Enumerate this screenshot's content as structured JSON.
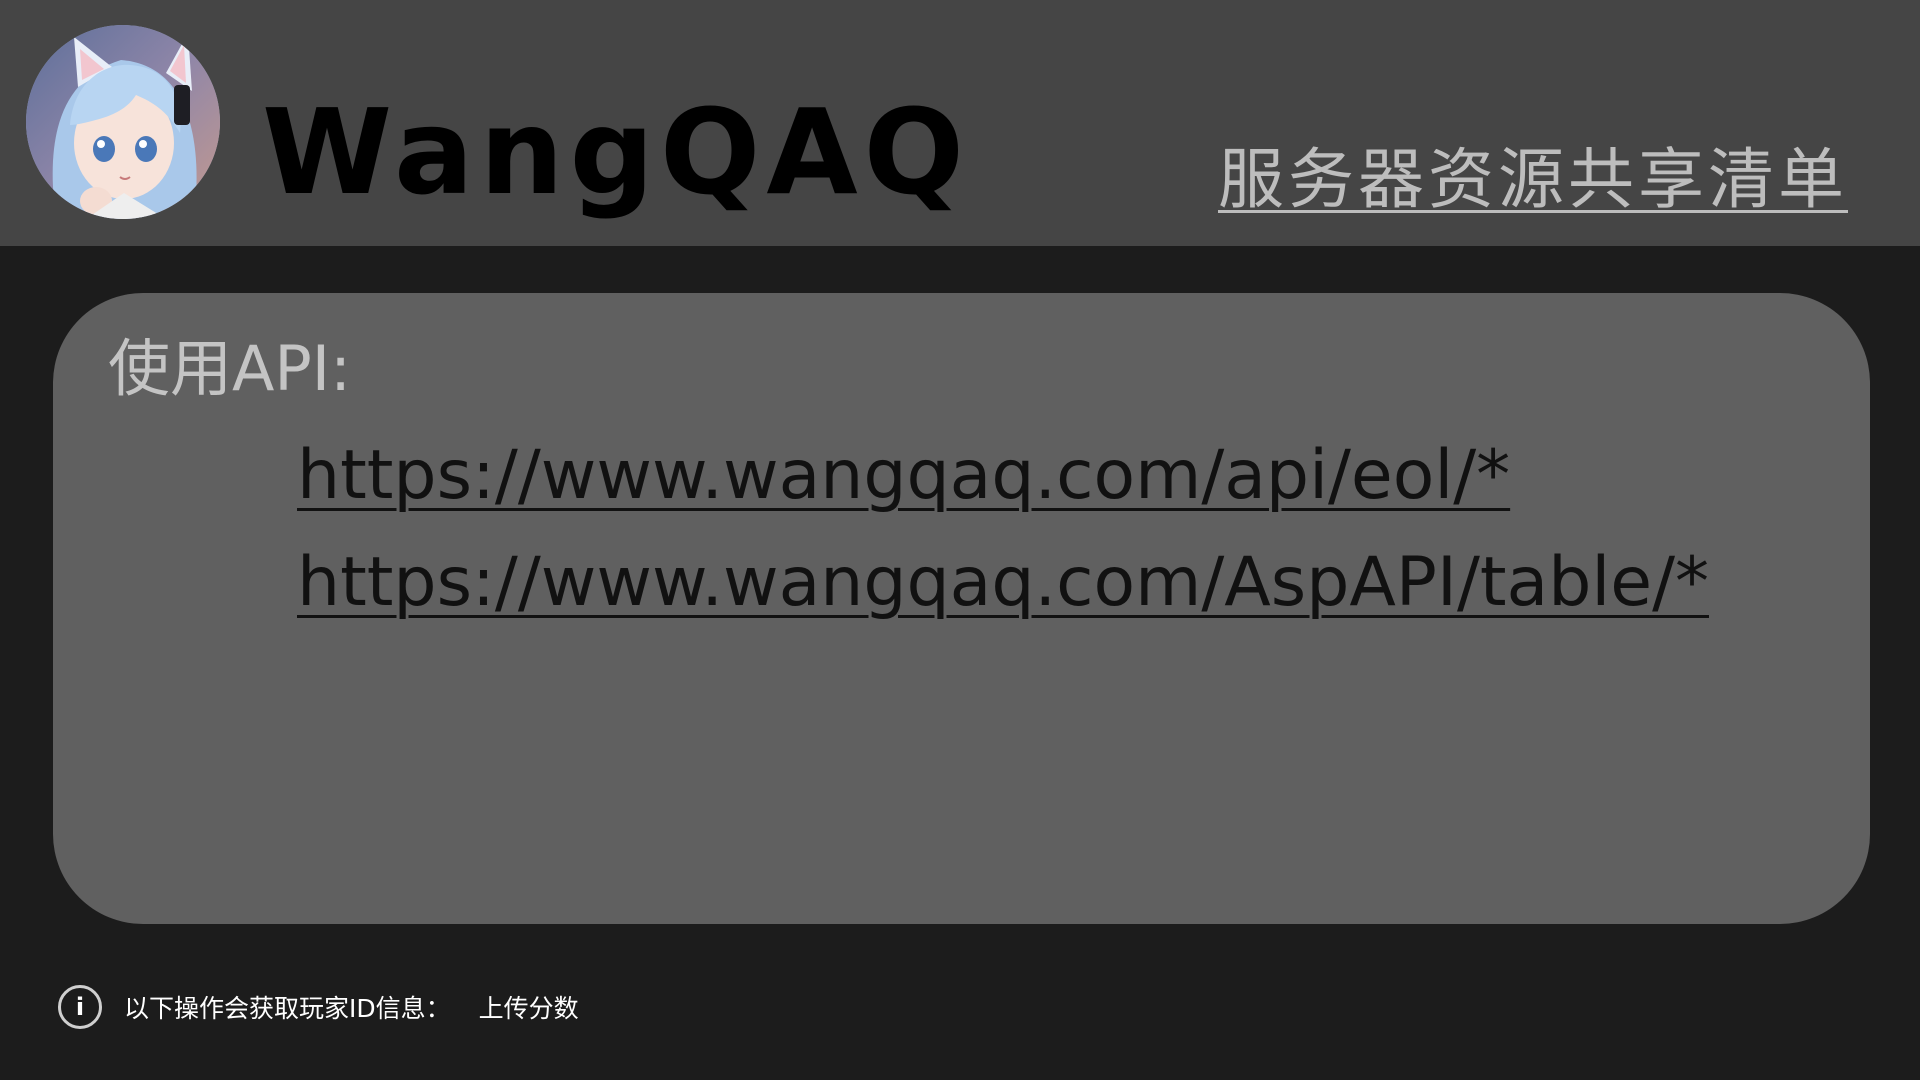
{
  "header": {
    "brand": "WangQAQ",
    "title": "服务器资源共享清单"
  },
  "panel": {
    "label": "使用API:",
    "links": [
      "https://www.wangqaq.com/api/eol/*",
      "https://www.wangqaq.com/AspAPI/table/*"
    ]
  },
  "notice": {
    "icon": "info-icon",
    "text": "以下操作会获取玩家ID信息：",
    "action": "上传分数"
  },
  "colors": {
    "header_bg": "#454545",
    "page_bg": "#1c1c1c",
    "panel_bg": "#606060",
    "title_text": "#bdbdbd",
    "link_text": "#111111"
  }
}
